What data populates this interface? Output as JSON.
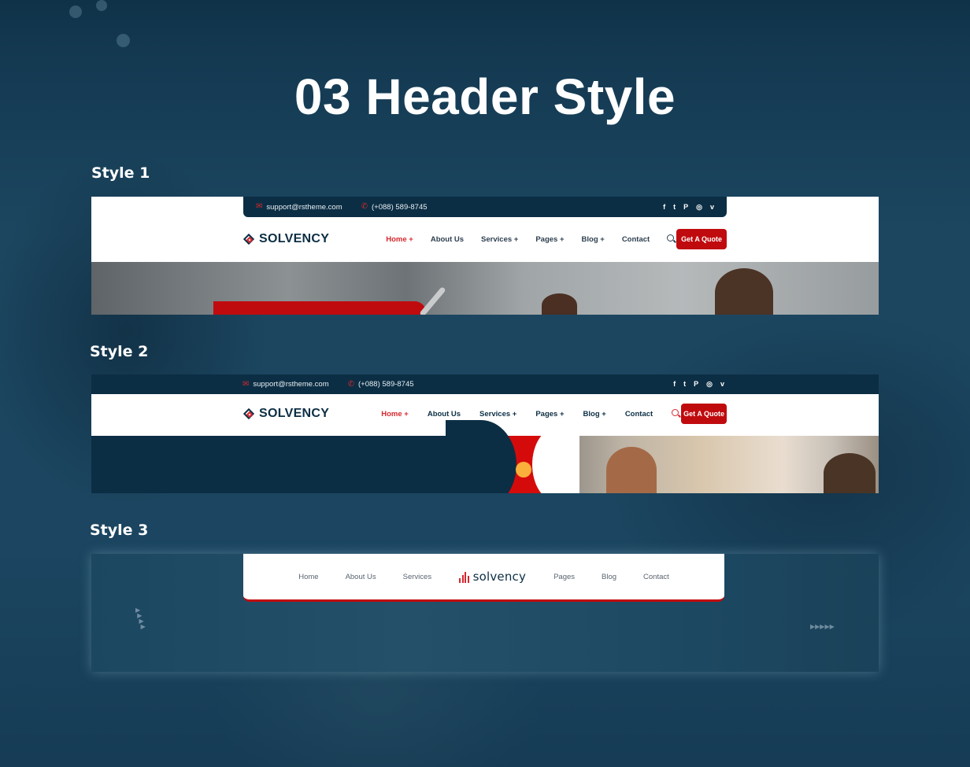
{
  "page": {
    "title": "03 Header Style"
  },
  "styles": [
    {
      "label": "Style 1",
      "topbar": {
        "email": "support@rstheme.com",
        "phone": "(+088) 589-8745",
        "socials": [
          "facebook-icon",
          "twitter-icon",
          "pinterest-icon",
          "instagram-icon",
          "vimeo-icon"
        ]
      },
      "logo": "SOLVENCY",
      "menu": [
        "Home +",
        "About Us",
        "Services +",
        "Pages +",
        "Blog +",
        "Contact"
      ],
      "active_item": "Home +",
      "cta": "Get A Quote"
    },
    {
      "label": "Style 2",
      "topbar": {
        "email": "support@rstheme.com",
        "phone": "(+088) 589-8745",
        "socials": [
          "facebook-icon",
          "twitter-icon",
          "pinterest-icon",
          "instagram-icon",
          "vimeo-icon"
        ]
      },
      "logo": "SOLVENCY",
      "menu": [
        "Home +",
        "About Us",
        "Services +",
        "Pages +",
        "Blog +",
        "Contact"
      ],
      "active_item": "Home +",
      "cta": "Get A Quote"
    },
    {
      "label": "Style 3",
      "logo": "solvency",
      "menu_left": [
        "Home",
        "About Us",
        "Services"
      ],
      "menu_right": [
        "Pages",
        "Blog",
        "Contact"
      ]
    }
  ],
  "social_glyphs": {
    "facebook": "f",
    "twitter": "🐦",
    "pinterest": "P",
    "instagram": "◎",
    "vimeo": "v"
  },
  "colors": {
    "brand_navy": "#0c2e44",
    "brand_red": "#c00b0e",
    "accent_yellow": "#fbb03b",
    "background": "#1b3e55"
  }
}
